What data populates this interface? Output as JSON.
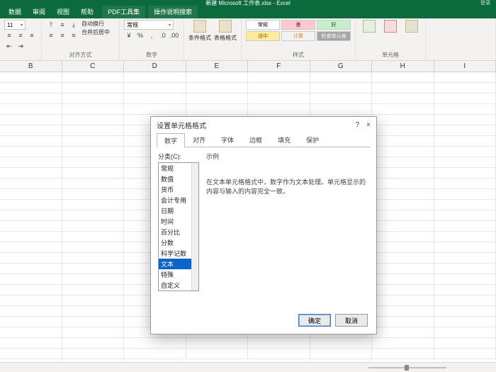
{
  "app": {
    "title": "新建 Microsoft 工作表.xlsx - Excel",
    "right_notice": "登录"
  },
  "tabs": [
    "数据",
    "审阅",
    "视图",
    "帮助",
    "PDF工具集",
    "操作说明搜索"
  ],
  "ribbon": {
    "font": {
      "size": "11",
      "group_label": "对齐方式"
    },
    "wrap": "自动换行",
    "merge": "合并后居中",
    "number": {
      "format": "常规",
      "group_label": "数字"
    },
    "cond": "条件格式",
    "table": "表格格式",
    "styles": {
      "normal": "常规",
      "bad": "差",
      "good": "好",
      "neutral": "适中",
      "calc": "计算",
      "check": "检查单元格",
      "group_label": "样式"
    },
    "cells_label": "单元格"
  },
  "columns": [
    "B",
    "C",
    "D",
    "E",
    "F",
    "G",
    "H",
    "I"
  ],
  "dialog": {
    "title": "设置单元格格式",
    "help": "?",
    "close": "×",
    "tabs": [
      "数字",
      "对齐",
      "字体",
      "边框",
      "填充",
      "保护"
    ],
    "cat_label": "分类(C):",
    "categories": [
      "常规",
      "数值",
      "货币",
      "会计专用",
      "日期",
      "时间",
      "百分比",
      "分数",
      "科学记数",
      "文本",
      "特殊",
      "自定义"
    ],
    "selected_index": 9,
    "sample_label": "示例",
    "description": "在文本单元格格式中，数字作为文本处理。单元格显示的内容与输入的内容完全一致。",
    "ok": "确定",
    "cancel": "取消"
  }
}
